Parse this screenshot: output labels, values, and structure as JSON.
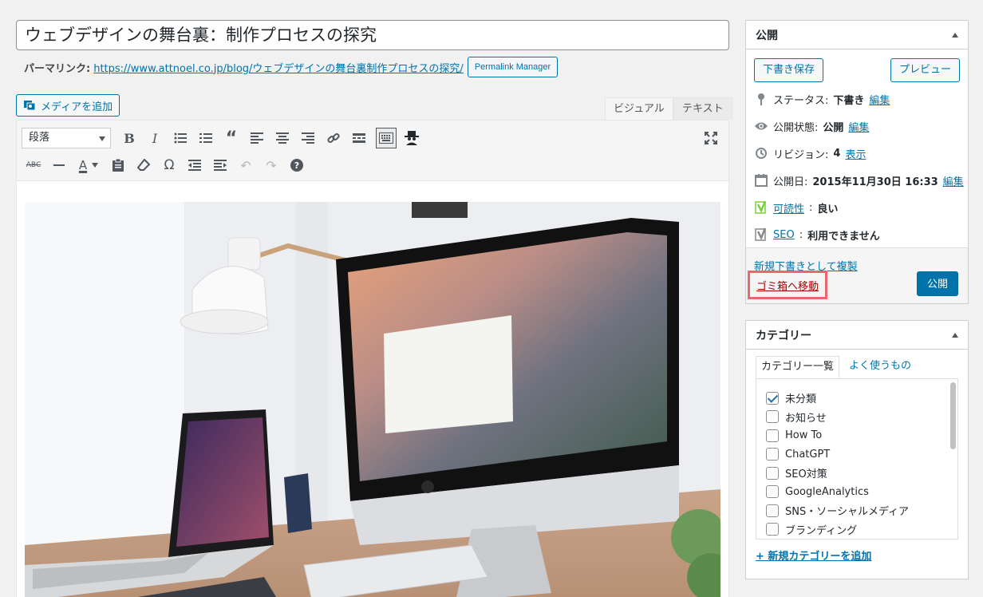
{
  "post": {
    "title": "ウェブデザインの舞台裏：制作プロセスの探究",
    "permalink_label": "パーマリンク:",
    "permalink_url": "https://www.attnoel.co.jp/blog/ウェブデザインの舞台裏制作プロセスの探究/",
    "permalink_manager_label": "Permalink Manager"
  },
  "editor": {
    "add_media_label": "メディアを追加",
    "tabs": {
      "visual": "ビジュアル",
      "text": "テキスト"
    },
    "format_select": "段落",
    "image_alt_icon": "photo-of-desk-with-imac-and-laptop"
  },
  "publish_box": {
    "title": "公開",
    "save_draft": "下書き保存",
    "preview": "プレビュー",
    "status_label": "ステータス:",
    "status_value": "下書き",
    "visibility_label": "公開状態:",
    "visibility_value": "公開",
    "revisions_label": "リビジョン:",
    "revisions_value": "4",
    "revisions_link": "表示",
    "date_label": "公開日:",
    "date_value": "2015年11月30日 16:33",
    "edit": "編集",
    "readability_link": "可読性",
    "readability_value": "良い",
    "seo_link": "SEO",
    "seo_value": "利用できません",
    "duplicate_link": "新規下書きとして複製",
    "trash_link": "ゴミ箱へ移動",
    "publish_button": "公開",
    "colors": {
      "highlight": "#e8686e",
      "primary": "#0073aa"
    }
  },
  "category_box": {
    "title": "カテゴリー",
    "tab_all": "カテゴリー一覧",
    "tab_popular": "よく使うもの",
    "items": [
      {
        "label": "未分類",
        "checked": true
      },
      {
        "label": "お知らせ",
        "checked": false
      },
      {
        "label": "How To",
        "checked": false
      },
      {
        "label": "ChatGPT",
        "checked": false
      },
      {
        "label": "SEO対策",
        "checked": false
      },
      {
        "label": "GoogleAnalytics",
        "checked": false
      },
      {
        "label": "SNS・ソーシャルメディア",
        "checked": false
      },
      {
        "label": "ブランディング",
        "checked": false
      }
    ],
    "add_new": "+ 新規カテゴリーを追加"
  }
}
